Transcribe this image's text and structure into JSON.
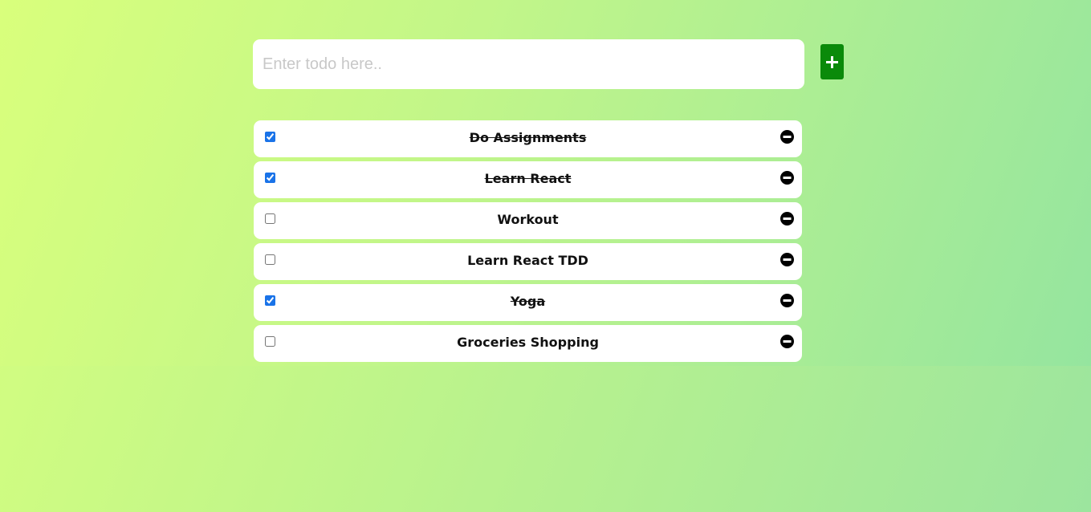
{
  "input": {
    "placeholder": "Enter todo here..",
    "value": ""
  },
  "add_button": {
    "icon": "plus-icon",
    "color": "#0a8a0a"
  },
  "todos": [
    {
      "label": "Do Assignments",
      "completed": true
    },
    {
      "label": "Learn React",
      "completed": true
    },
    {
      "label": "Workout",
      "completed": false
    },
    {
      "label": "Learn React TDD",
      "completed": false
    },
    {
      "label": "Yoga",
      "completed": true
    },
    {
      "label": "Groceries Shopping",
      "completed": false
    }
  ],
  "remove_icon": "minus-circle-icon"
}
